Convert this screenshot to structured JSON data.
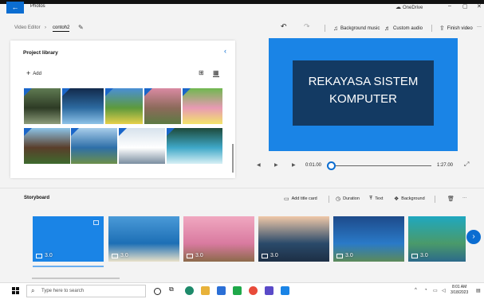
{
  "window": {
    "app_name": "Photos",
    "back_icon": "arrow-left-icon",
    "onedrive_label": "OneDrive",
    "minimize_glyph": "–",
    "maximize_glyph": "▢",
    "close_glyph": "✕"
  },
  "breadcrumb": {
    "root": "Video Editor",
    "separator": "›",
    "current": "contoh2"
  },
  "toolbar": {
    "undo_glyph": "↶",
    "redo_glyph": "↷",
    "background_music": "Background music",
    "custom_audio": "Custom audio",
    "finish_video": "Finish video",
    "more": "···"
  },
  "library": {
    "title": "Project library",
    "add_label": "Add",
    "collapse_glyph": "‹",
    "thumbnails": [
      {
        "name": "ruins",
        "colors": [
          "#5f7a52",
          "#2d3b25",
          "#8c9c7a"
        ]
      },
      {
        "name": "night-tree",
        "colors": [
          "#122a4c",
          "#2c6aa0",
          "#8dc2e8"
        ]
      },
      {
        "name": "tulip-field",
        "colors": [
          "#4a8fd6",
          "#5d9a3c",
          "#e6d04a"
        ]
      },
      {
        "name": "cherry-path",
        "colors": [
          "#d98aa2",
          "#8c6a5a",
          "#5c7a43"
        ]
      },
      {
        "name": "garden-flowers",
        "colors": [
          "#6fb84f",
          "#e89ab4",
          "#f2e46a"
        ]
      },
      {
        "name": "wood-cabin",
        "colors": [
          "#8cc4e8",
          "#5a3e2a",
          "#3e6a2e"
        ]
      },
      {
        "name": "river-village",
        "colors": [
          "#a8cdea",
          "#2e6fa8",
          "#6d8f4a"
        ]
      },
      {
        "name": "snow-cabin",
        "colors": [
          "#d7e2ec",
          "#ffffff",
          "#7a8ea0"
        ]
      },
      {
        "name": "waterfall",
        "colors": [
          "#1d4a3a",
          "#3fa8c8",
          "#d7f0f5"
        ]
      }
    ]
  },
  "preview": {
    "title_line1": "REKAYASA SISTEM",
    "title_line2": "KOMPUTER",
    "current_time": "0:01.00",
    "total_time": "1:27.00",
    "progress": 0.0,
    "background_color": "#1a84e6",
    "card_color": "#133a63"
  },
  "storyboard": {
    "title": "Storyboard",
    "add_title_card": "Add title card",
    "duration": "Duration",
    "text": "Text",
    "background": "Background",
    "more": "···",
    "clips": [
      {
        "duration": "3.0",
        "selected": true,
        "colors": [
          "#1a84e6",
          "#1a84e6",
          "#1a84e6"
        ]
      },
      {
        "duration": "3.0",
        "selected": false,
        "colors": [
          "#4a9ad8",
          "#1d6fb5",
          "#e8e0c8"
        ]
      },
      {
        "duration": "3.0",
        "selected": false,
        "colors": [
          "#f0a8c0",
          "#d97aa0",
          "#8c6a4a"
        ]
      },
      {
        "duration": "3.0",
        "selected": false,
        "colors": [
          "#f0c8a8",
          "#2a4a6a",
          "#1d2f45"
        ]
      },
      {
        "duration": "3.0",
        "selected": false,
        "colors": [
          "#1d4a8a",
          "#2a7ac8",
          "#5c8a5a"
        ]
      },
      {
        "duration": "3.0",
        "selected": false,
        "colors": [
          "#1fa8c0",
          "#4a9a6a",
          "#2c6a8a"
        ]
      }
    ]
  },
  "taskbar": {
    "search_placeholder": "Type here to search",
    "time": "8:01 AM",
    "date": "3/18/2023"
  }
}
